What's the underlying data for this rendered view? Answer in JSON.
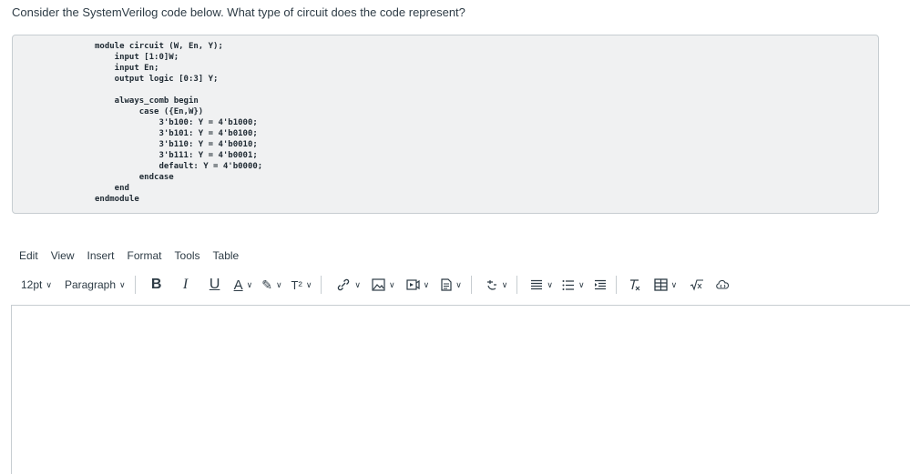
{
  "question": "Consider the SystemVerilog code below. What type of circuit does the code represent?",
  "code_lines": [
    "module circuit (W, En, Y);",
    "    input [1:0]W;",
    "    input En;",
    "    output logic [0:3] Y;",
    "",
    "    always_comb begin",
    "         case ({En,W})",
    "             3'b100: Y = 4'b1000;",
    "             3'b101: Y = 4'b0100;",
    "             3'b110: Y = 4'b0010;",
    "             3'b111: Y = 4'b0001;",
    "             default: Y = 4'b0000;",
    "         endcase",
    "    end",
    "endmodule"
  ],
  "menu": {
    "edit": "Edit",
    "view": "View",
    "insert": "Insert",
    "format": "Format",
    "tools": "Tools",
    "table": "Table"
  },
  "toolbar": {
    "font_size": "12pt",
    "block_format": "Paragraph",
    "bold": "B",
    "italic": "I",
    "underline": "U",
    "text_color": "A",
    "highlight": "✎",
    "superscript": "T²",
    "chevron": "∨",
    "icons": [
      "link-icon",
      "image-icon",
      "media-icon",
      "document-icon",
      "apps-icon",
      "align-icon",
      "list-icon",
      "indent-icon",
      "clear-format-icon",
      "table-icon",
      "math-icon",
      "embed-icon"
    ]
  }
}
